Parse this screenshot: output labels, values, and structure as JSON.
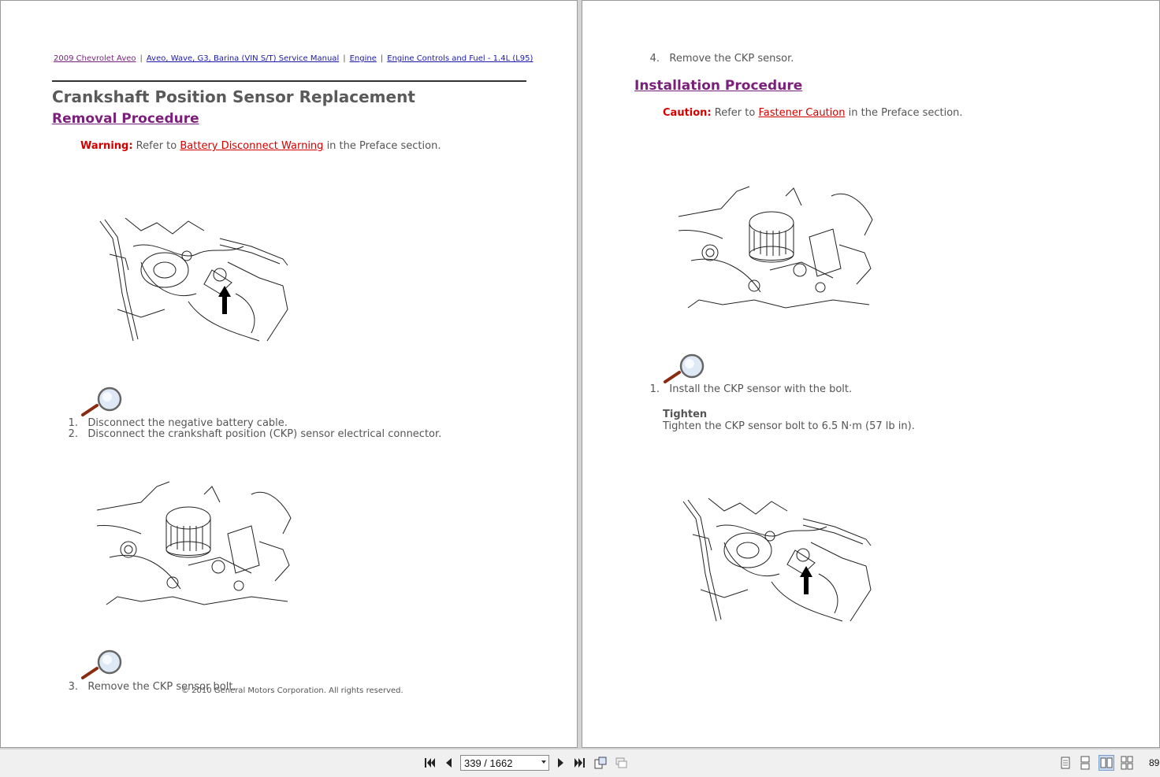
{
  "breadcrumb": {
    "items": [
      "2009 Chevrolet Aveo",
      "Aveo, Wave, G3, Barina (VIN S/T) Service Manual",
      "Engine",
      "Engine Controls and Fuel - 1.4L (L95)"
    ],
    "separator": "|"
  },
  "left_page": {
    "title": "Crankshaft Position Sensor Replacement",
    "section": "Removal Procedure",
    "warning": {
      "label": "Warning:",
      "pre": "Refer to",
      "link": "Battery Disconnect Warning",
      "post": "in the Preface section."
    },
    "steps_a": [
      {
        "num": "1.",
        "text": "Disconnect the negative battery cable."
      },
      {
        "num": "2.",
        "text": "Disconnect the crankshaft position (CKP) sensor electrical connector."
      }
    ],
    "steps_b": [
      {
        "num": "3.",
        "text": "Remove the CKP sensor bolt."
      }
    ],
    "copyright": "© 2010 General Motors Corporation.  All rights reserved."
  },
  "right_page": {
    "step4": {
      "num": "4.",
      "text": "Remove the CKP sensor."
    },
    "section": "Installation Procedure",
    "caution": {
      "label": "Caution:",
      "pre": "Refer to",
      "link": "Fastener Caution",
      "post": "in the Preface section."
    },
    "step1": {
      "num": "1.",
      "text": "Install the CKP sensor with the bolt."
    },
    "tighten_heading": "Tighten",
    "tighten_text": "Tighten the CKP sensor bolt to 6.5 N·m (57 lb in)."
  },
  "toolbar": {
    "page_field": "339 / 1662",
    "zoom": "89"
  },
  "colors": {
    "link_visited": "#7a1f7a",
    "link": "#1a1aaa",
    "alert": "#d40000",
    "text": "#555555"
  },
  "icons": [
    "first-page-icon",
    "prev-page-icon",
    "next-page-icon",
    "last-page-icon",
    "rotate-view-icon",
    "fit-view-icon",
    "single-page-icon",
    "continuous-icon",
    "two-page-icon",
    "two-page-continuous-icon",
    "magnifier-icon"
  ]
}
